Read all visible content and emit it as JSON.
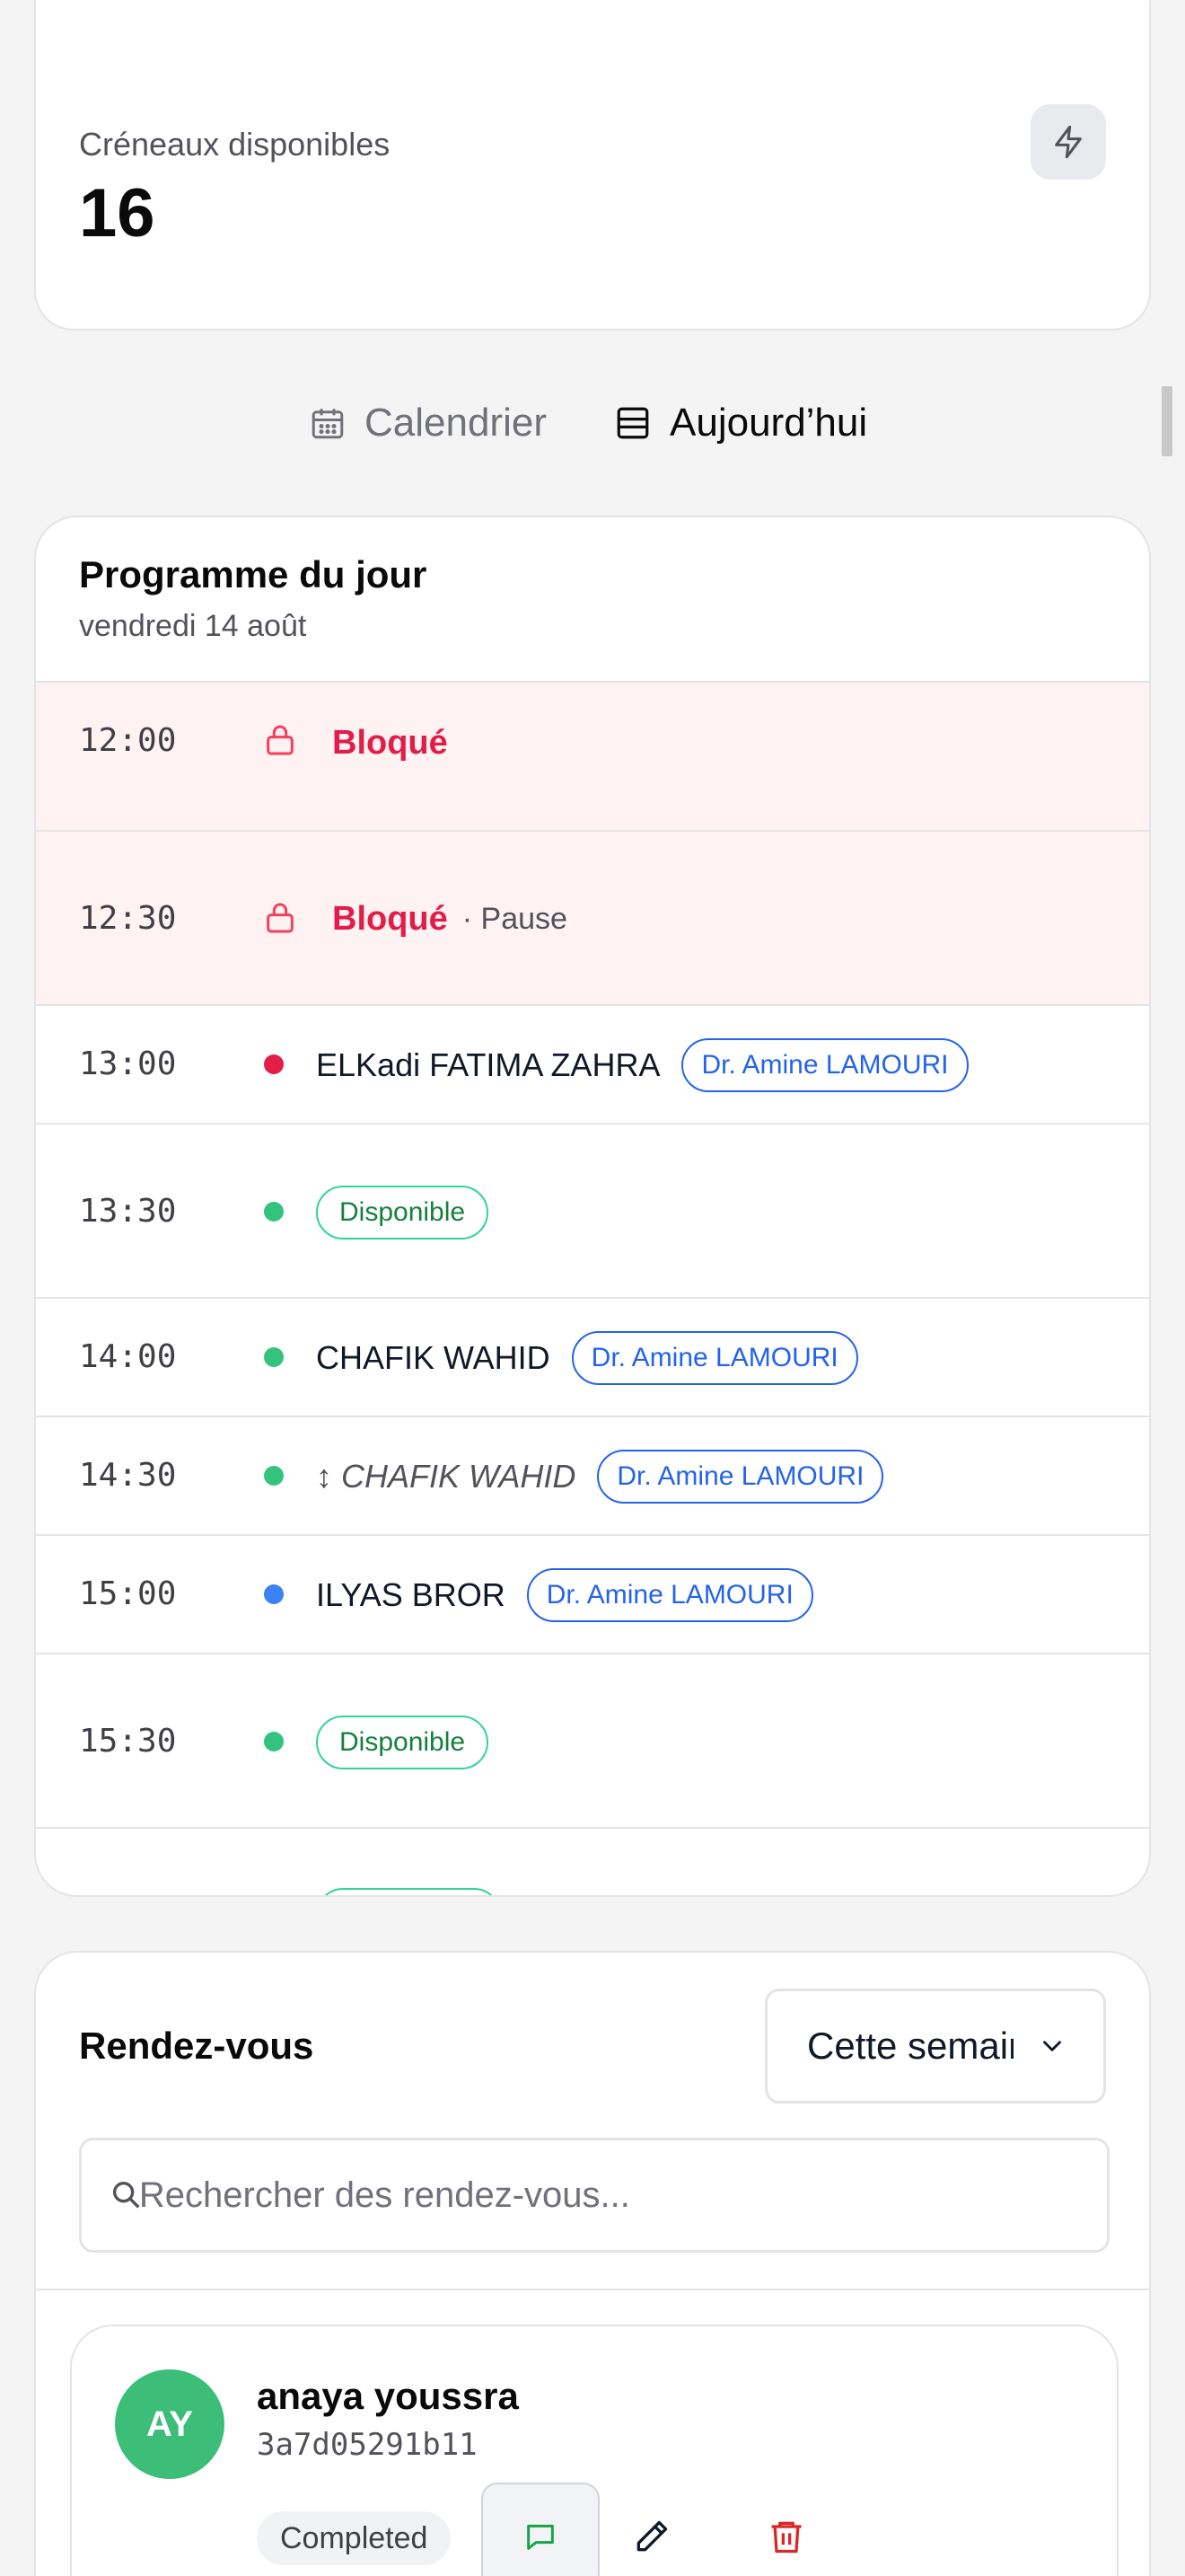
{
  "stats": {
    "label": "Créneaux disponibles",
    "value": "16",
    "icon": "lightning-icon"
  },
  "view_toggle": {
    "calendar_label": "Calendrier",
    "today_label": "Aujourd’hui",
    "active": "today"
  },
  "schedule": {
    "title": "Programme du jour",
    "date": "vendredi 14 août",
    "slots": [
      {
        "time": "12:00",
        "type": "blocked",
        "label": "Bloqué",
        "note": ""
      },
      {
        "time": "12:30",
        "type": "blocked",
        "label": "Bloqué",
        "note": "· Pause"
      },
      {
        "time": "13:00",
        "type": "booked",
        "patient": "ELKadi FATIMA ZAHRA",
        "doctor": "Dr. Amine LAMOURI",
        "dot_color": "#e11d48"
      },
      {
        "time": "13:30",
        "type": "available",
        "label": "Disponible",
        "dot_color": "#34c37f"
      },
      {
        "time": "14:00",
        "type": "booked",
        "patient": "CHAFIK WAHID",
        "doctor": "Dr. Amine LAMOURI",
        "dot_color": "#34c37f"
      },
      {
        "time": "14:30",
        "type": "moved",
        "patient": "↕ CHAFIK WAHID",
        "doctor": "Dr. Amine LAMOURI",
        "dot_color": "#34c37f"
      },
      {
        "time": "15:00",
        "type": "booked",
        "patient": "ILYAS BROR",
        "doctor": "Dr. Amine LAMOURI",
        "dot_color": "#3b82f6"
      },
      {
        "time": "15:30",
        "type": "available",
        "label": "Disponible",
        "dot_color": "#34c37f"
      }
    ]
  },
  "appointments": {
    "title": "Rendez-vous",
    "period_value": "Cette semaine",
    "search_placeholder": "Rechercher des rendez-vous...",
    "items": [
      {
        "initials": "AY",
        "name": "anaya youssra",
        "id": "3a7d05291b11",
        "status": "Completed",
        "avatar_color": "#3cbd78"
      }
    ]
  },
  "colors": {
    "blocked": "#e11d48",
    "doctor": "#2563eb",
    "available": "#15803d"
  }
}
